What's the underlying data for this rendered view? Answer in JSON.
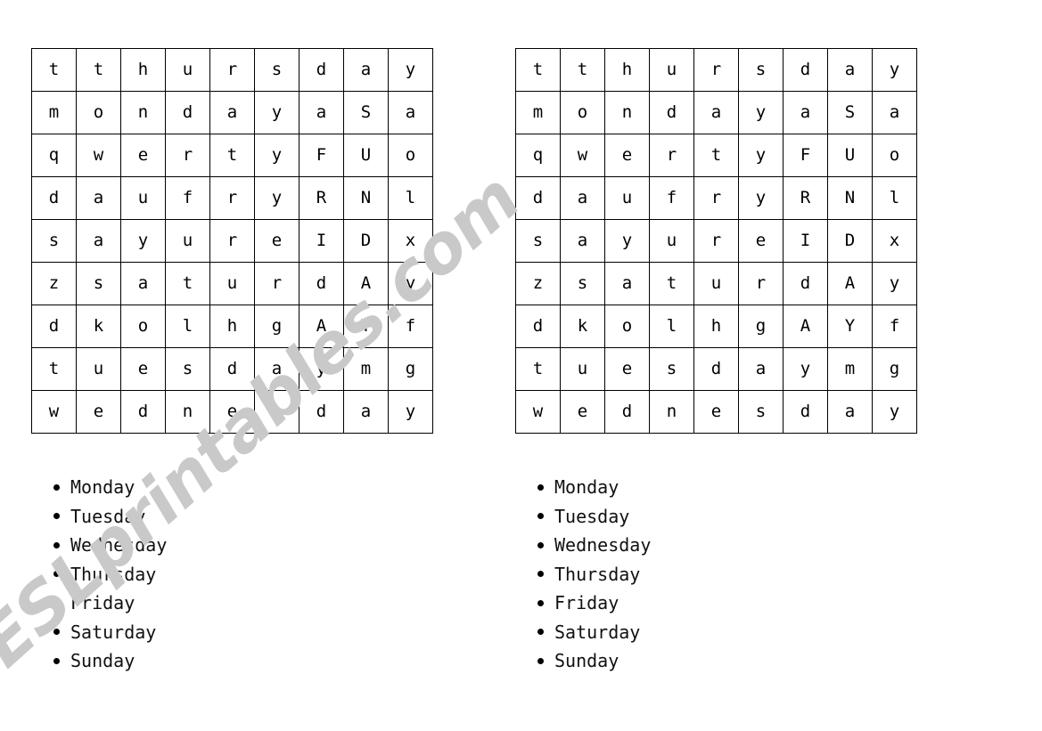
{
  "document": {
    "type": "word-search-worksheet",
    "topic": "Days of the Week",
    "background_color": "#ffffff",
    "text_color": "#000000",
    "grid_border_color": "#000000"
  },
  "watermark": {
    "text": "ESLprintables.com",
    "color": "#c9c9c9",
    "rotation_degrees": -42
  },
  "puzzles": [
    {
      "id": "puzzle-left",
      "grid": {
        "rows": 9,
        "columns": 9,
        "letters": [
          [
            "t",
            "t",
            "h",
            "u",
            "r",
            "s",
            "d",
            "a",
            "y"
          ],
          [
            "m",
            "o",
            "n",
            "d",
            "a",
            "y",
            "a",
            "S",
            "a"
          ],
          [
            "q",
            "w",
            "e",
            "r",
            "t",
            "y",
            "F",
            "U",
            "o"
          ],
          [
            "d",
            "a",
            "u",
            "f",
            "r",
            "y",
            "R",
            "N",
            "l"
          ],
          [
            "s",
            "a",
            "y",
            "u",
            "r",
            "e",
            "I",
            "D",
            "x"
          ],
          [
            "z",
            "s",
            "a",
            "t",
            "u",
            "r",
            "d",
            "A",
            "y"
          ],
          [
            "d",
            "k",
            "o",
            "l",
            "h",
            "g",
            "A",
            "Y",
            "f"
          ],
          [
            "t",
            "u",
            "e",
            "s",
            "d",
            "a",
            "y",
            "m",
            "g"
          ],
          [
            "w",
            "e",
            "d",
            "n",
            "e",
            "s",
            "d",
            "a",
            "y"
          ]
        ]
      },
      "words": [
        "Monday",
        "Tuesday",
        "Wednesday",
        "Thursday",
        "Friday",
        "Saturday",
        "Sunday"
      ]
    },
    {
      "id": "puzzle-right",
      "grid": {
        "rows": 9,
        "columns": 9,
        "letters": [
          [
            "t",
            "t",
            "h",
            "u",
            "r",
            "s",
            "d",
            "a",
            "y"
          ],
          [
            "m",
            "o",
            "n",
            "d",
            "a",
            "y",
            "a",
            "S",
            "a"
          ],
          [
            "q",
            "w",
            "e",
            "r",
            "t",
            "y",
            "F",
            "U",
            "o"
          ],
          [
            "d",
            "a",
            "u",
            "f",
            "r",
            "y",
            "R",
            "N",
            "l"
          ],
          [
            "s",
            "a",
            "y",
            "u",
            "r",
            "e",
            "I",
            "D",
            "x"
          ],
          [
            "z",
            "s",
            "a",
            "t",
            "u",
            "r",
            "d",
            "A",
            "y"
          ],
          [
            "d",
            "k",
            "o",
            "l",
            "h",
            "g",
            "A",
            "Y",
            "f"
          ],
          [
            "t",
            "u",
            "e",
            "s",
            "d",
            "a",
            "y",
            "m",
            "g"
          ],
          [
            "w",
            "e",
            "d",
            "n",
            "e",
            "s",
            "d",
            "a",
            "y"
          ]
        ]
      },
      "words": [
        "Monday",
        "Tuesday",
        "Wednesday",
        "Thursday",
        "Friday",
        "Saturday",
        "Sunday"
      ]
    }
  ]
}
